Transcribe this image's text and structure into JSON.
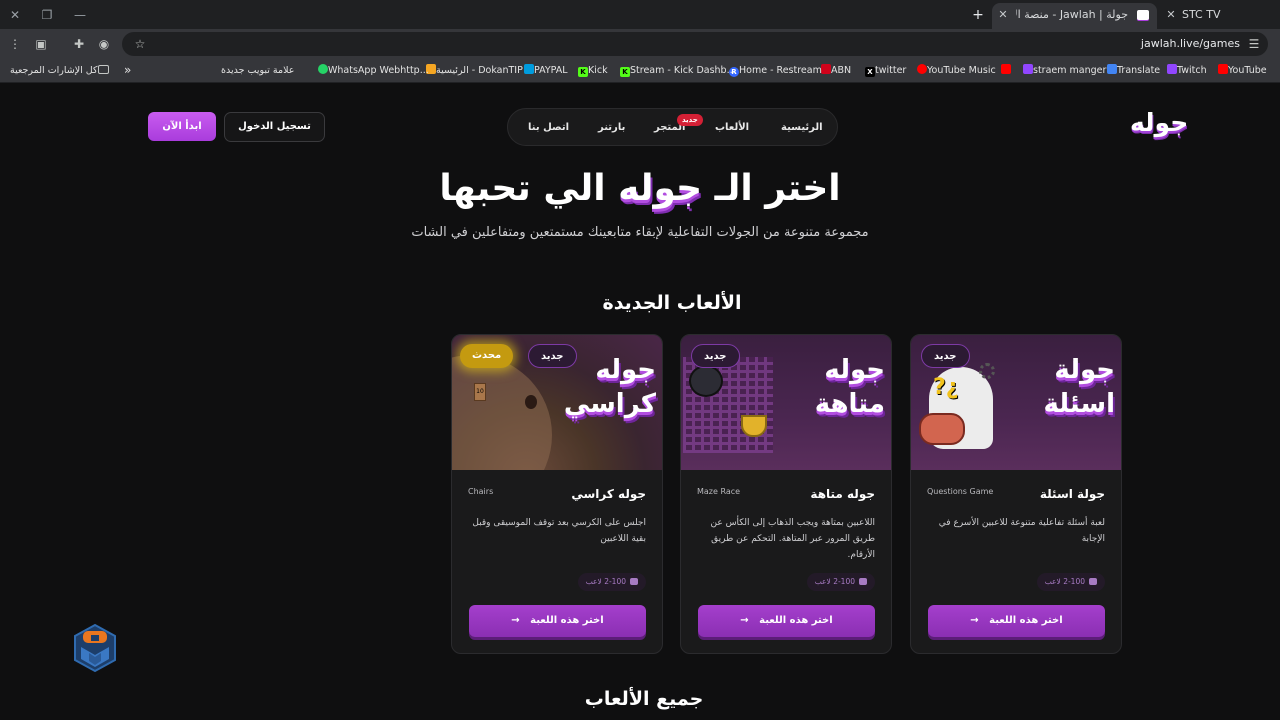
{
  "browser": {
    "tabs": [
      {
        "title": "STC TV",
        "active": false
      },
      {
        "title": "جولة | Jawlah - منصة الألعاب التفاعلية",
        "active": true
      }
    ],
    "new_tab": "+",
    "url": "jawlah.live/games",
    "bookmarks": [
      {
        "label": "YouTube",
        "icon_color": "#ff0000"
      },
      {
        "label": "Twitch",
        "icon_color": "#9146ff"
      },
      {
        "label": "Translate",
        "icon_color": "#4285f4"
      },
      {
        "label": "straem manger",
        "icon_color": "#9146ff"
      },
      {
        "label": "",
        "icon_color": "#ff0000"
      },
      {
        "label": "YouTube Music",
        "icon_color": "#ff0000"
      },
      {
        "label": "twitter",
        "icon_color": "#000000"
      },
      {
        "label": "ABN",
        "icon_color": "#d0021b"
      },
      {
        "label": "Home - Restream",
        "icon_color": "#3467ff"
      },
      {
        "label": "Stream - Kick Dashb...",
        "icon_color": "#53fc18"
      },
      {
        "label": "Kick",
        "icon_color": "#53fc18"
      },
      {
        "label": "PAYPAL",
        "icon_color": "#009cde"
      },
      {
        "label": "الرئيسية - DokanTIP",
        "icon_color": "#f5a623"
      },
      {
        "label": "WhatsApp Webhttp...",
        "icon_color": "#25d366"
      },
      {
        "label": "علامة تبويب جديدة",
        "icon_color": ""
      }
    ],
    "bookmarks_overflow": "»",
    "all_bookmarks": "كل الإشارات المرجعية"
  },
  "site": {
    "logo": "جوله",
    "nav": [
      {
        "label": "الرئيسية"
      },
      {
        "label": "الألعاب"
      },
      {
        "label": "المتجر",
        "badge": "جديد"
      },
      {
        "label": "بارتنر"
      },
      {
        "label": "اتصل بنا"
      }
    ],
    "login_button": "تسجيل الدخول",
    "start_button": "ابدأ الآن"
  },
  "hero": {
    "title_prefix": "اختر الـ",
    "title_accent": "جوله",
    "title_suffix": "الي تحبها",
    "subtitle": "مجموعة متنوعة من الجولات التفاعلية لإبقاء متابعينك مستمتعين ومتفاعلين في الشات"
  },
  "new_games_title": "الألعاب الجديدة",
  "all_games_title": "جميع الألعاب",
  "games": [
    {
      "name_ar": "جوله كراسي",
      "name_en": "Chairs",
      "thumb_title": "جوله\nكراسي",
      "badges": [
        "جديد",
        "محدث"
      ],
      "description": "اجلس على الكرسي بعد توقف الموسيقى وقبل بقية اللاعبين",
      "players": "2-100 لاعب",
      "button": "اختر هذه اللعبة",
      "arrow": "→",
      "art_number": "10"
    },
    {
      "name_ar": "جوله متاهة",
      "name_en": "Maze Race",
      "thumb_title": "جوله\nمتاهة",
      "badges": [
        "جديد"
      ],
      "description": "اللاعبين بمتاهة ويجب الذهاب إلى الكأس عن طريق المرور عبر المتاهة. التحكم عن طريق الأرقام.",
      "players": "2-100 لاعب",
      "button": "اختر هذه اللعبة",
      "arrow": "→"
    },
    {
      "name_ar": "جولة اسئلة",
      "name_en": "Questions Game",
      "thumb_title": "جولة\nاسئلة",
      "badges": [
        "جديد"
      ],
      "description": "لعبة أسئلة تفاعلية متنوعة للاعبين الأسرع في الإجابة",
      "players": "2-100 لاعب",
      "button": "اختر هذه اللعبة",
      "arrow": "→",
      "art_text": "?¿"
    }
  ],
  "colors": {
    "accent": "#a93cdc",
    "background": "#0f0f10",
    "card": "#1a1a1b",
    "badge_updated": "#c49a10",
    "store_badge": "#d42035"
  }
}
